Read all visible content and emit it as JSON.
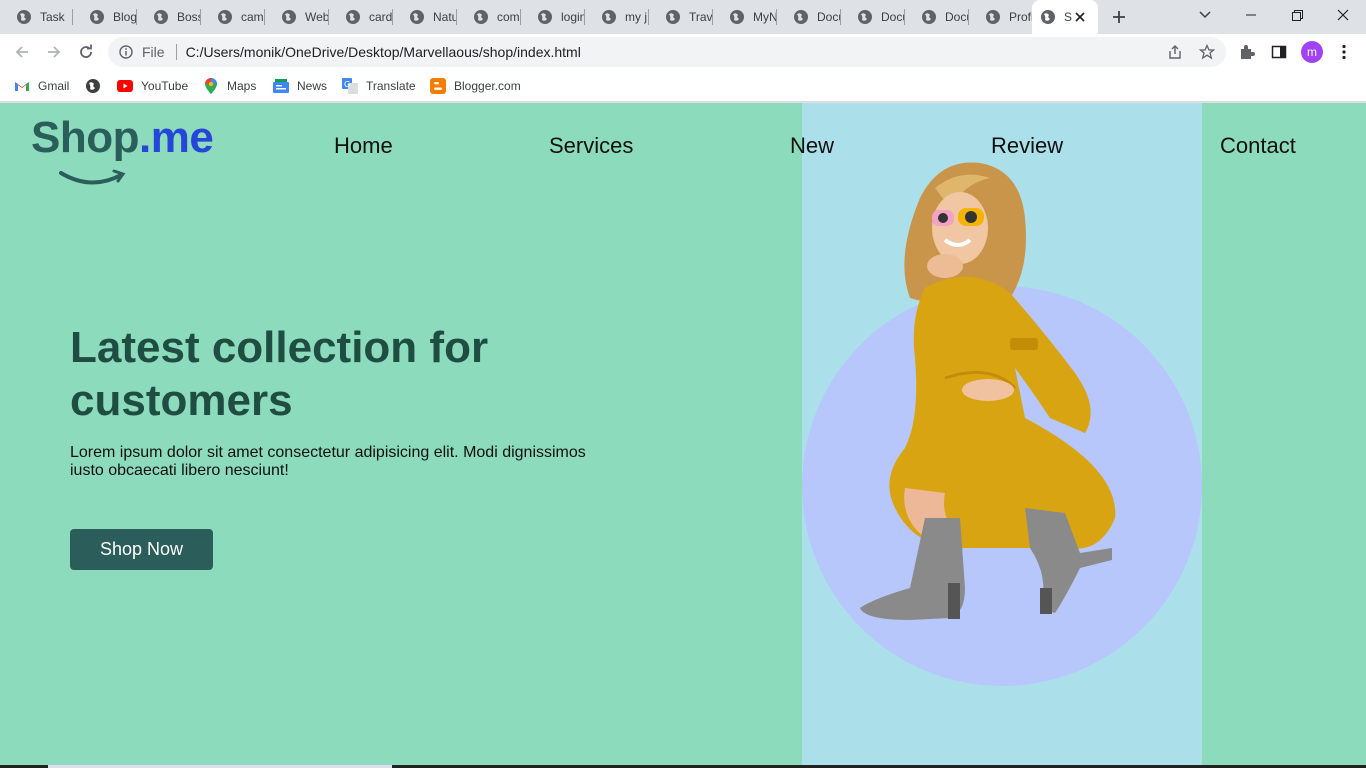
{
  "browser": {
    "tabs": [
      {
        "label": "Task"
      },
      {
        "label": "Blog"
      },
      {
        "label": "Boss"
      },
      {
        "label": "cam"
      },
      {
        "label": "Web"
      },
      {
        "label": "card"
      },
      {
        "label": "Natu"
      },
      {
        "label": "com"
      },
      {
        "label": "login"
      },
      {
        "label": "my j"
      },
      {
        "label": "Trav"
      },
      {
        "label": "MyN"
      },
      {
        "label": "Docu"
      },
      {
        "label": "Docu"
      },
      {
        "label": "Docu"
      },
      {
        "label": "Profi"
      },
      {
        "label": "S"
      }
    ],
    "address": {
      "scheme": "File",
      "url": "C:/Users/monik/OneDrive/Desktop/Marvellaous/shop/index.html"
    },
    "profile_initial": "m",
    "bookmarks": [
      {
        "label": "Gmail",
        "icon": "gmail-icon"
      },
      {
        "label": "",
        "icon": "globe-icon"
      },
      {
        "label": "YouTube",
        "icon": "youtube-icon"
      },
      {
        "label": "Maps",
        "icon": "maps-icon"
      },
      {
        "label": "News",
        "icon": "news-icon"
      },
      {
        "label": "Translate",
        "icon": "translate-icon"
      },
      {
        "label": "Blogger.com",
        "icon": "blogger-icon"
      }
    ]
  },
  "site": {
    "logo": {
      "part1": "Shop",
      "part2": ".me"
    },
    "nav": [
      "Home",
      "Services",
      "New",
      "Review",
      "Contact"
    ],
    "hero": {
      "headline": "Latest collection for customers",
      "description": "Lorem ipsum dolor sit amet consectetur adipisicing elit. Modi dignissimos iusto obcaecati libero nesciunt!",
      "button": "Shop Now"
    },
    "colors": {
      "background": "#8cdbbd",
      "panel": "#abe0eb",
      "circle": "#b7c6fb",
      "accent": "#2b5d5a",
      "logo_blue": "#2546d8"
    }
  }
}
